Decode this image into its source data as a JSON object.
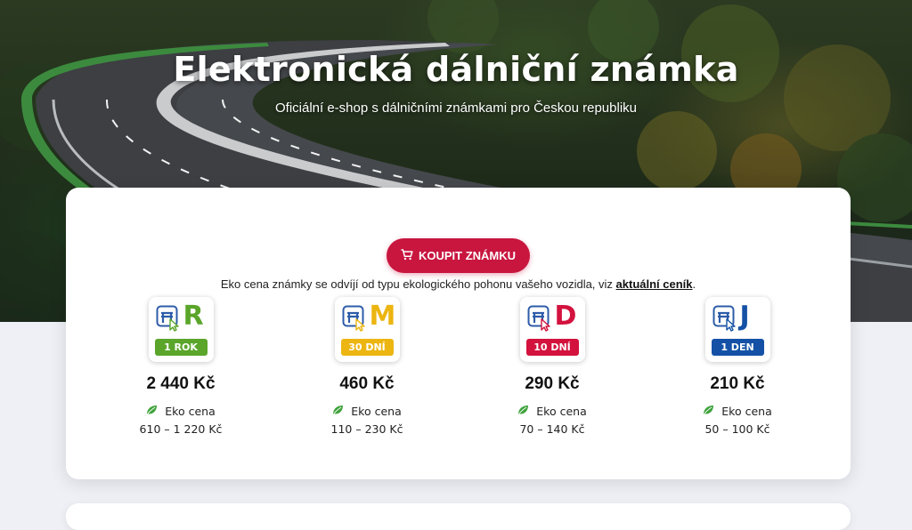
{
  "hero": {
    "title": "Elektronická dálniční známka",
    "subtitle": "Oficiální e-shop s dálničními známkami pro Českou republiku"
  },
  "cta": {
    "buy_label": "KOUPIT ZNÁMKU",
    "icon": "cart-icon",
    "color": "#c8163f"
  },
  "info": {
    "text": "Eko cena známky se odvíjí od typu ekologického pohonu vašeho vozidla, viz ",
    "link": "aktuální ceník",
    "end": "."
  },
  "products": [
    {
      "letter": "R",
      "badge": "1 ROK",
      "price": "2 440 Kč",
      "eco_label": "Eko cena",
      "eco_range": "610 – 1 220 Kč",
      "color": "#5aa52a"
    },
    {
      "letter": "M",
      "badge": "30 DNÍ",
      "price": "460 Kč",
      "eco_label": "Eko cena",
      "eco_range": "110 – 230 Kč",
      "color": "#ecb512"
    },
    {
      "letter": "D",
      "badge": "10 DNÍ",
      "price": "290 Kč",
      "eco_label": "Eko cena",
      "eco_range": "70 – 140 Kč",
      "color": "#d3123d"
    },
    {
      "letter": "J",
      "badge": "1 DEN",
      "price": "210 Kč",
      "eco_label": "Eko cena",
      "eco_range": "50 – 100 Kč",
      "color": "#1451a6"
    }
  ],
  "icons": {
    "leaf": "leaf-icon",
    "logo": "highway-vignette-logo-icon"
  },
  "colors": {
    "leaf": "#3fa33c",
    "logo_blue": "#2d5ca8"
  }
}
